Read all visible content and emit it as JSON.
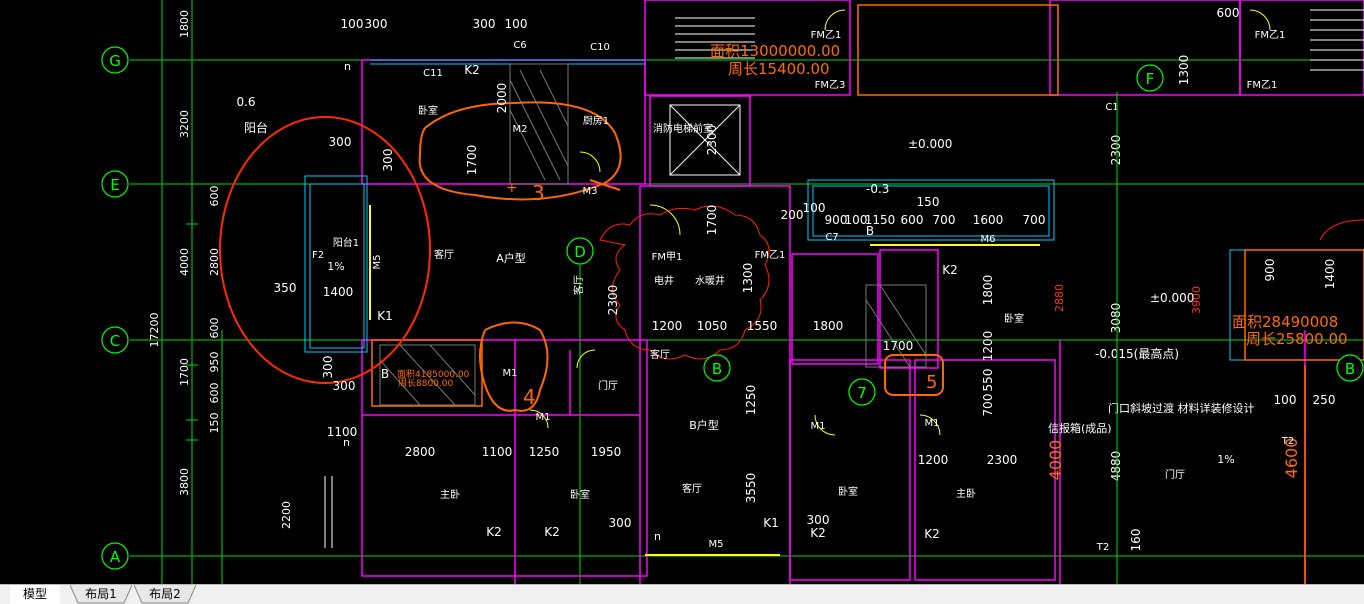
{
  "tabs": [
    {
      "label": "模型",
      "active": true
    },
    {
      "label": "布局1",
      "active": false
    },
    {
      "label": "布局2",
      "active": false
    }
  ],
  "colors": {
    "background": "#000000",
    "axis": "#00ff00",
    "wall": "#ff00ff",
    "dimension": "#00ff00",
    "text": "#ffffff",
    "area_annotation": "#ff6a00",
    "markup": "#ff3300",
    "window": "#00ccff",
    "door": "#ffff00"
  },
  "grid_axes": {
    "rows": [
      "G",
      "E",
      "C",
      "A"
    ],
    "cols": [
      "D",
      "B",
      "7",
      "F",
      "B"
    ]
  },
  "dimensions": {
    "left_chain": [
      "1800",
      "3200",
      "600",
      "2800",
      "4000",
      "600",
      "17200",
      "950",
      "1700",
      "600",
      "150",
      "3800",
      "2200"
    ],
    "top": [
      "100",
      "300",
      "300",
      "100"
    ],
    "room_a": [
      "300",
      "300",
      "1400",
      "350",
      "300",
      "300",
      "1700",
      "2000"
    ],
    "row_mid": [
      "1200",
      "1050",
      "1550",
      "1800",
      "1700",
      "2300",
      "1300",
      "1700",
      "2300"
    ],
    "row_b": [
      "200",
      "100",
      "900",
      "100",
      "1150",
      "600",
      "700",
      "1600",
      "700",
      "150"
    ],
    "row_bottom": [
      "2800",
      "1100",
      "1250",
      "1950",
      "1100",
      "1200",
      "2300",
      "3550",
      "1250",
      "300",
      "300"
    ],
    "right": [
      "1800",
      "1200",
      "550",
      "700",
      "3080",
      "4880",
      "2300",
      "1300",
      "600",
      "900",
      "1400",
      "250",
      "100",
      "160"
    ],
    "right_red": [
      "2880",
      "3900",
      "4000",
      "4600"
    ]
  },
  "labels": {
    "balcony_note": "0.6",
    "balcony_name": "阳台",
    "balcony_room": "阳台1",
    "slope": "1%",
    "slope2": "1%",
    "k1": "K1",
    "k2": "K2",
    "m5": "M5",
    "m1": "M1",
    "m2": "M2",
    "m3": "M3",
    "b1": "B",
    "c11": "C11",
    "c6": "C6",
    "c10": "C10",
    "c7": "C7",
    "c1": "C1",
    "m6": "M6",
    "t2": "T2",
    "f2": "F2",
    "unit_a": "A户型",
    "unit_b": "B户型",
    "bedroom": "卧室",
    "living": "客厅",
    "kitchen": "厨房1",
    "master": "主卧",
    "fire_stair": "消防电梯前室",
    "elec_well": "电井",
    "water_well": "水暖井",
    "lobby": "门厅",
    "fm1": "FM乙1",
    "fm2": "FM甲1",
    "fm3": "FM乙3",
    "elevation_zero": "±0.000",
    "elevation_low": "-0.3",
    "elevation_highest": "-0.015(最高点)",
    "door_note": "门口斜坡过渡  材料详装修设计",
    "mailbox": "信报箱(成品)",
    "area_1": "面积13000000.00",
    "perimeter_1": "周长15400.00",
    "area_2": "面积28490008",
    "perimeter_2": "周长25800.00",
    "area_3": "面积4185000.00",
    "perimeter_3": "周长8800.00",
    "markup_3": "3",
    "markup_4": "4",
    "markup_5": "5",
    "plus": "+",
    "arrow_n": "n"
  }
}
